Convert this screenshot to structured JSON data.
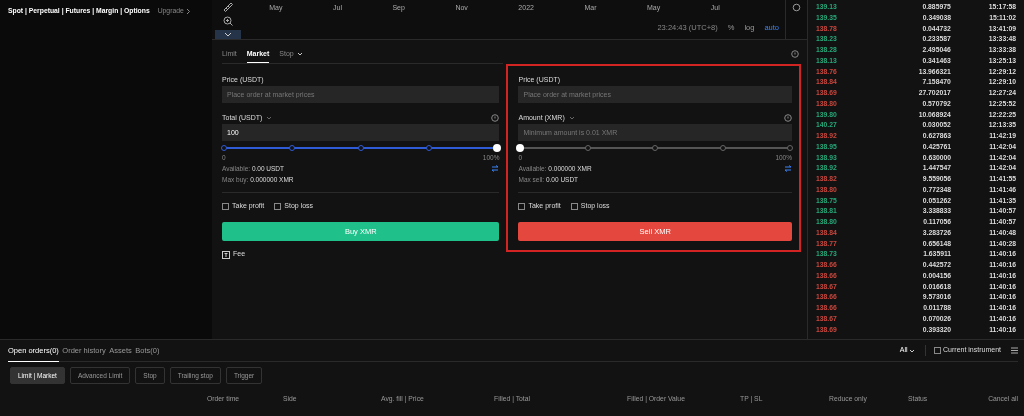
{
  "product_nav": {
    "text": "Spot | Perpetual | Futures | Margin | Options",
    "upgrade": "Upgrade"
  },
  "chart": {
    "x_labels": [
      "May",
      "Jul",
      "Sep",
      "Nov",
      "2022",
      "Mar",
      "May",
      "Jul"
    ],
    "time": "23:24:43 (UTC+8)",
    "scale_options": [
      {
        "label": "%",
        "selected": false
      },
      {
        "label": "log",
        "selected": false
      },
      {
        "label": "auto",
        "selected": true
      }
    ]
  },
  "order_form": {
    "tabs": [
      {
        "label": "Limit",
        "selected": false,
        "dropdown": false
      },
      {
        "label": "Market",
        "selected": true,
        "dropdown": false
      },
      {
        "label": "Stop",
        "selected": false,
        "dropdown": true
      }
    ],
    "panels": [
      {
        "kind": "buy",
        "highlighted": false,
        "price_label": "Price (USDT)",
        "price_placeholder": "Place order at market prices",
        "qty_label": "Total (USDT)",
        "qty_value": "100",
        "slider": {
          "level": 1,
          "min_label": "0",
          "max_label": "100%"
        },
        "available_label": "Available:",
        "available": "0.00 USDT",
        "max_label": "Max buy:",
        "max": "0.000000 XMR",
        "options": [
          {
            "label": "Take profit",
            "checked": false
          },
          {
            "label": "Stop loss",
            "checked": false
          }
        ],
        "button": "Buy XMR"
      },
      {
        "kind": "sell",
        "highlighted": true,
        "price_label": "Price (USDT)",
        "price_placeholder": "Place order at market prices",
        "qty_label": "Amount (XMR)",
        "qty_placeholder": "Minimum amount is 0.01 XMR",
        "slider": {
          "level": 0,
          "min_label": "0",
          "max_label": "100%"
        },
        "available_label": "Available:",
        "available": "0.000000 XMR",
        "max_label": "Max sell:",
        "max": "0.00 USDT",
        "options": [
          {
            "label": "Take profit",
            "checked": false
          },
          {
            "label": "Stop loss",
            "checked": false
          }
        ],
        "button": "Sell XMR"
      }
    ],
    "fee": "Fee"
  },
  "trades": [
    {
      "price": "139.13",
      "amount": "0.885975",
      "time": "15:17:58",
      "kind": "buy"
    },
    {
      "price": "139.35",
      "amount": "0.349038",
      "time": "15:11:02",
      "kind": "buy"
    },
    {
      "price": "138.78",
      "amount": "0.044732",
      "time": "13:41:09",
      "kind": "sell"
    },
    {
      "price": "138.23",
      "amount": "0.233587",
      "time": "13:33:48",
      "kind": "buy"
    },
    {
      "price": "138.28",
      "amount": "2.495046",
      "time": "13:33:38",
      "kind": "buy"
    },
    {
      "price": "138.13",
      "amount": "0.341463",
      "time": "13:25:13",
      "kind": "buy"
    },
    {
      "price": "138.76",
      "amount": "13.966321",
      "time": "12:29:12",
      "kind": "sell"
    },
    {
      "price": "138.84",
      "amount": "7.158470",
      "time": "12:29:10",
      "kind": "sell"
    },
    {
      "price": "138.69",
      "amount": "27.702017",
      "time": "12:27:24",
      "kind": "sell"
    },
    {
      "price": "138.80",
      "amount": "0.570792",
      "time": "12:25:52",
      "kind": "sell"
    },
    {
      "price": "139.80",
      "amount": "10.068924",
      "time": "12:22:25",
      "kind": "buy"
    },
    {
      "price": "140.27",
      "amount": "0.030052",
      "time": "12:13:35",
      "kind": "buy"
    },
    {
      "price": "138.92",
      "amount": "0.627863",
      "time": "11:42:19",
      "kind": "sell"
    },
    {
      "price": "138.95",
      "amount": "0.425761",
      "time": "11:42:04",
      "kind": "buy"
    },
    {
      "price": "138.93",
      "amount": "0.630000",
      "time": "11:42:04",
      "kind": "buy"
    },
    {
      "price": "138.92",
      "amount": "1.447547",
      "time": "11:42:04",
      "kind": "buy"
    },
    {
      "price": "138.82",
      "amount": "9.559056",
      "time": "11:41:55",
      "kind": "sell"
    },
    {
      "price": "138.80",
      "amount": "0.772348",
      "time": "11:41:46",
      "kind": "sell"
    },
    {
      "price": "138.75",
      "amount": "0.051262",
      "time": "11:41:35",
      "kind": "buy"
    },
    {
      "price": "138.81",
      "amount": "3.338833",
      "time": "11:40:57",
      "kind": "buy"
    },
    {
      "price": "138.80",
      "amount": "0.117056",
      "time": "11:40:57",
      "kind": "buy"
    },
    {
      "price": "138.84",
      "amount": "3.283726",
      "time": "11:40:48",
      "kind": "sell"
    },
    {
      "price": "138.77",
      "amount": "0.656148",
      "time": "11:40:28",
      "kind": "sell"
    },
    {
      "price": "138.73",
      "amount": "1.635911",
      "time": "11:40:16",
      "kind": "buy"
    },
    {
      "price": "138.66",
      "amount": "0.442572",
      "time": "11:40:16",
      "kind": "sell"
    },
    {
      "price": "138.66",
      "amount": "0.004156",
      "time": "11:40:16",
      "kind": "sell"
    },
    {
      "price": "138.67",
      "amount": "0.016618",
      "time": "11:40:16",
      "kind": "sell"
    },
    {
      "price": "138.66",
      "amount": "9.573016",
      "time": "11:40:16",
      "kind": "sell"
    },
    {
      "price": "138.66",
      "amount": "0.011788",
      "time": "11:40:16",
      "kind": "sell"
    },
    {
      "price": "138.67",
      "amount": "0.070026",
      "time": "11:40:16",
      "kind": "sell"
    },
    {
      "price": "138.69",
      "amount": "0.393320",
      "time": "11:40:16",
      "kind": "sell"
    }
  ],
  "orders": {
    "tabs": [
      {
        "label": "Open orders(0)",
        "selected": true
      },
      {
        "label": "Order history",
        "selected": false
      },
      {
        "label": "Assets",
        "selected": false
      },
      {
        "label": "Bots(0)",
        "selected": false
      }
    ],
    "filter": "All",
    "current_instrument": {
      "label": "Current instrument",
      "checked": false
    },
    "order_types": [
      {
        "label": "Limit | Market",
        "selected": true
      },
      {
        "label": "Advanced Limit",
        "selected": false
      },
      {
        "label": "Stop",
        "selected": false
      },
      {
        "label": "Trailing stop",
        "selected": false
      },
      {
        "label": "Trigger",
        "selected": false
      }
    ],
    "columns": [
      "Order time",
      "Side",
      "Avg. fill | Price",
      "Filled | Total",
      "Filled | Order Value",
      "TP | SL",
      "Reduce only",
      "Status"
    ],
    "cancel_all": "Cancel all"
  }
}
